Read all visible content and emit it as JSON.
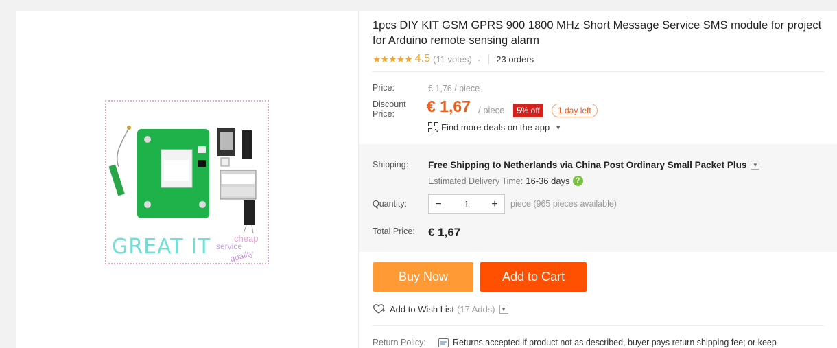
{
  "product": {
    "title": "1pcs DIY KIT GSM GPRS 900 1800 MHz Short Message Service SMS module for project for Arduino remote sensing alarm",
    "stars": "★★★★★",
    "rating": "4.5",
    "votes": "(11 votes)",
    "orders": "23 orders",
    "image_watermark": "GREAT IT",
    "image_tags": [
      "cheap",
      "service",
      "quality"
    ]
  },
  "price": {
    "price_label": "Price:",
    "old_price": "€ 1,76 / piece",
    "discount_label_1": "Discount",
    "discount_label_2": "Price:",
    "current_price": "€ 1,67",
    "per_piece": "/ piece",
    "off_badge": "5% off",
    "days_left": "1 day left",
    "app_deals": "Find more deals on the app"
  },
  "shipping": {
    "label": "Shipping:",
    "text": "Free Shipping to Netherlands via China Post Ordinary Small Packet Plus",
    "est_label": "Estimated Delivery Time:",
    "est_value": "16-36 days"
  },
  "quantity": {
    "label": "Quantity:",
    "value": "1",
    "minus": "−",
    "plus": "+",
    "available": "piece (965 pieces available)"
  },
  "total": {
    "label": "Total Price:",
    "value": "€ 1,67"
  },
  "actions": {
    "buy_now": "Buy Now",
    "add_to_cart": "Add to Cart",
    "wishlist": "Add to Wish List",
    "wishlist_count": "(17 Adds)"
  },
  "policy": {
    "label": "Return Policy:",
    "text": "Returns accepted if product not as described, buyer pays return shipping fee; or keep"
  },
  "colors": {
    "accent": "#f25c19",
    "buy_now": "#ff9a35",
    "add_to_cart": "#ff4f00",
    "rating": "#f5a623",
    "badge": "#d8201c"
  }
}
